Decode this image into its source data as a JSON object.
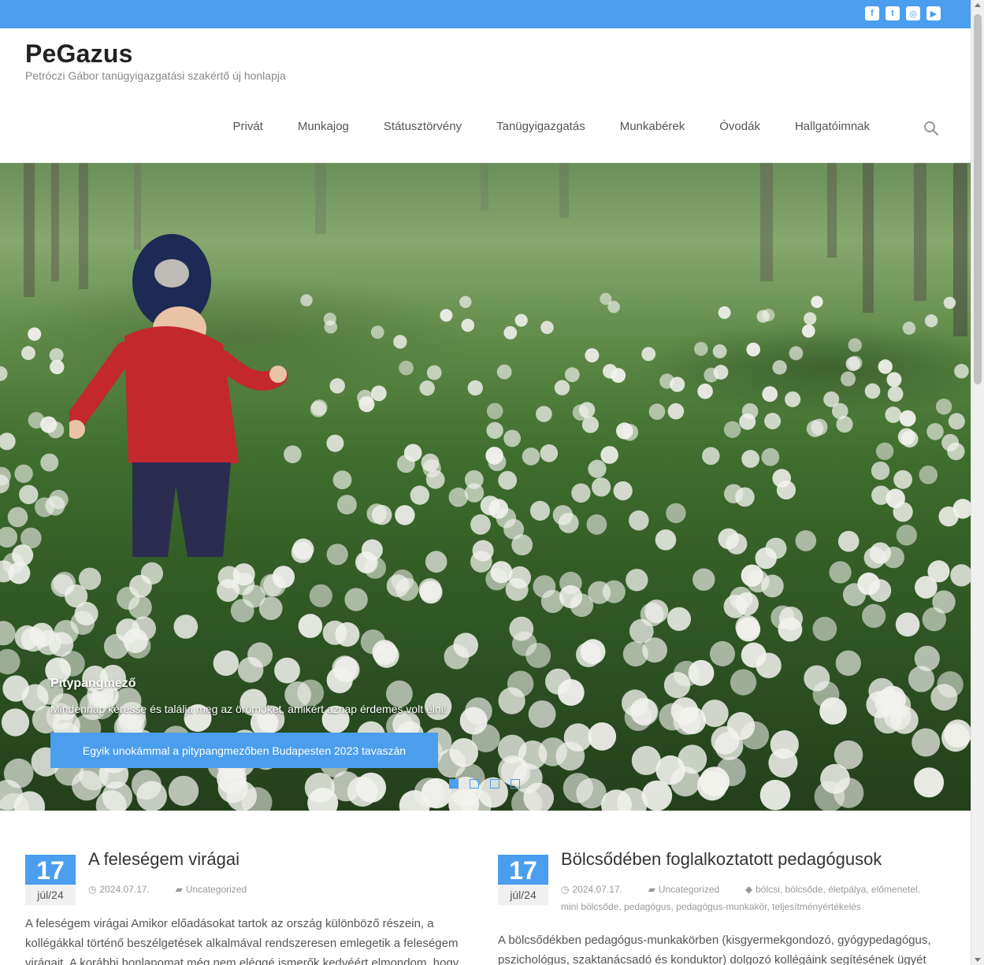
{
  "site": {
    "title": "PeGazus",
    "tagline": "Petróczi Gábor tanügyigazgatási szakértő új honlapja"
  },
  "social": [
    {
      "icon": "facebook-icon",
      "glyph": "f"
    },
    {
      "icon": "twitter-icon",
      "glyph": "t"
    },
    {
      "icon": "instagram-icon",
      "glyph": "◎"
    },
    {
      "icon": "youtube-icon",
      "glyph": "▶"
    }
  ],
  "nav": {
    "items": [
      "Privát",
      "Munkajog",
      "Státusztörvény",
      "Tanügyigazgatás",
      "Munkabérek",
      "Óvodák",
      "Hallgatóimnak"
    ]
  },
  "slider": {
    "title": "Pitypangmező",
    "text": "Mindennap keresse és találja meg az örömöket, amikért aznap érdemes volt élni!",
    "button_label": "Egyik unokámmal a pitypangmezőben Budapesten 2023 tavaszán",
    "slide_count": 4,
    "active_slide": 1
  },
  "posts": [
    {
      "day": "17",
      "month": "júl/24",
      "title": "A feleségem virágai",
      "date": "2024.07.17.",
      "category": "Uncategorized",
      "tags": [],
      "excerpt": "A feleségem virágai Amikor előadásokat tartok az ország különböző részein, a kollégákkal történő beszélgetések alkalmával rendszeresen emlegetik a feleségem virágait. A korábbi honlapomat még nem eléggé ismerők kedvéért elmondom, hogy a"
    },
    {
      "day": "17",
      "month": "júl/24",
      "title": "Bölcsődében foglalkoztatott pedagógusok",
      "date": "2024.07.17.",
      "category": "Uncategorized",
      "tags": [
        "bölcsi",
        "bölcsőde",
        "életpálya",
        "előmenetel",
        "mini bölcsőde",
        "pedagógus",
        "pedagógus-munkakör",
        "teljesítményértékelés"
      ],
      "excerpt": "A bölcsődékben pedagógus-munkakörben (kisgyermekgondozó, gyógypedagógus, pszichológus, szaktanácsadó és konduktor) dolgozó kollégáink segítésének ügyét"
    }
  ],
  "colors": {
    "accent": "#4a9eed",
    "text": "#333333",
    "muted": "#999999"
  }
}
